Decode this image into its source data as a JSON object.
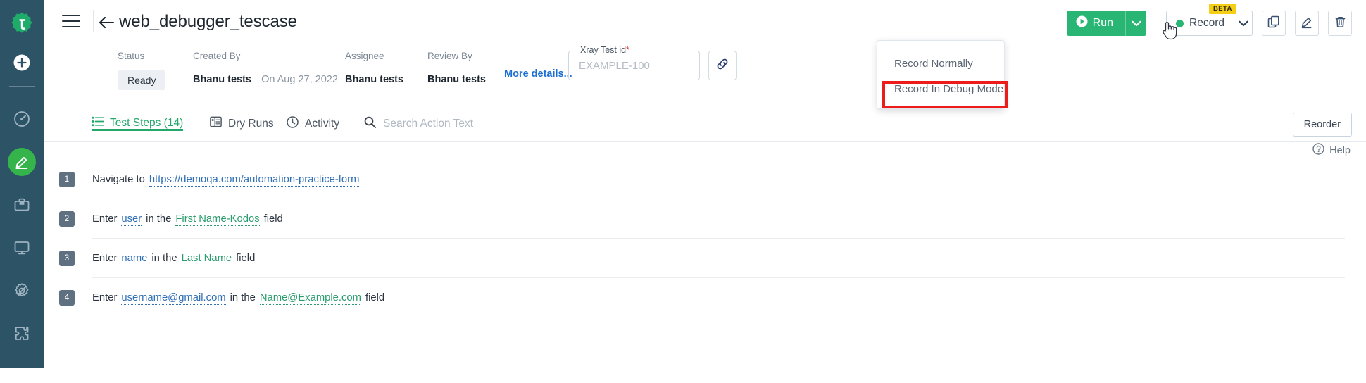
{
  "sidebar": {
    "logo_icon": "taas-logo-icon",
    "add_label": "plus-icon",
    "items": [
      {
        "icon": "dashboard-speedometer-icon",
        "name": "dashboard",
        "active": false
      },
      {
        "icon": "pencil-edit-icon",
        "name": "authoring",
        "active": true
      },
      {
        "icon": "briefcase-icon",
        "name": "projects",
        "active": false
      },
      {
        "icon": "monitor-screen-icon",
        "name": "devices",
        "active": false
      },
      {
        "icon": "bug-settings-icon",
        "name": "debug",
        "active": false
      },
      {
        "icon": "puzzle-piece-icon",
        "name": "integrations",
        "active": false
      }
    ]
  },
  "header": {
    "menu_icon": "hamburger-menu-icon",
    "back_icon": "back-arrow-icon",
    "title": "web_debugger_tescase",
    "run_label": "Run",
    "run_icon": "play-circle-icon",
    "run_caret_icon": "chevron-down-icon",
    "record_label": "Record",
    "record_status_icon": "record-dot-icon",
    "beta_badge": "BETA",
    "record_caret_icon": "chevron-down-icon",
    "copy_icon": "copy-duplicate-icon",
    "edit_icon": "pencil-edit-icon",
    "delete_icon": "trash-delete-icon",
    "accent_green": "#29b573",
    "beta_yellow": "#f5cf16"
  },
  "record_menu": {
    "items": [
      {
        "label": "Record Normally",
        "highlighted": false
      },
      {
        "label": "Record In Debug Mode",
        "highlighted": true
      }
    ],
    "highlight_color": "#ee1b1b"
  },
  "meta": {
    "status": {
      "label": "Status",
      "value": "Ready"
    },
    "created_by": {
      "label": "Created By",
      "value": "Bhanu tests",
      "date": "On Aug 27, 2022"
    },
    "assignee": {
      "label": "Assignee",
      "value": "Bhanu tests"
    },
    "review_by": {
      "label": "Review By",
      "value": "Bhanu tests"
    },
    "more_details": "More details...",
    "xray": {
      "legend": "Xray Test id",
      "required_mark": "*",
      "value": "",
      "placeholder": "EXAMPLE-100"
    },
    "link_icon": "link-chain-icon"
  },
  "tabs": {
    "items": [
      {
        "label": "Test Steps (14)",
        "icon": "list-icon",
        "active": true
      },
      {
        "label": "Dry Runs",
        "icon": "grid-table-icon",
        "active": false
      },
      {
        "label": "Activity",
        "icon": "clock-icon",
        "active": false
      }
    ],
    "search": {
      "icon": "search-icon",
      "value": "",
      "placeholder": "Search Action Text"
    },
    "reorder_label": "Reorder"
  },
  "help": {
    "icon": "question-circle-icon",
    "label": "Help"
  },
  "steps": [
    {
      "number": "1",
      "parts": [
        {
          "type": "plain",
          "text": "Navigate to"
        },
        {
          "type": "link",
          "text": "https://demoqa.com/automation-practice-form"
        }
      ]
    },
    {
      "number": "2",
      "parts": [
        {
          "type": "plain",
          "text": "Enter"
        },
        {
          "type": "blue",
          "text": "user"
        },
        {
          "type": "plain",
          "text": "in the"
        },
        {
          "type": "green",
          "text": "First Name-Kodos"
        },
        {
          "type": "plain",
          "text": "field"
        }
      ]
    },
    {
      "number": "3",
      "parts": [
        {
          "type": "plain",
          "text": "Enter"
        },
        {
          "type": "blue",
          "text": "name"
        },
        {
          "type": "plain",
          "text": "in the"
        },
        {
          "type": "green",
          "text": "Last Name"
        },
        {
          "type": "plain",
          "text": "field"
        }
      ]
    },
    {
      "number": "4",
      "parts": [
        {
          "type": "plain",
          "text": "Enter"
        },
        {
          "type": "blue",
          "text": "username@gmail.com"
        },
        {
          "type": "plain",
          "text": "in the"
        },
        {
          "type": "green",
          "text": "Name@Example.com"
        },
        {
          "type": "plain",
          "text": "field"
        }
      ]
    }
  ]
}
